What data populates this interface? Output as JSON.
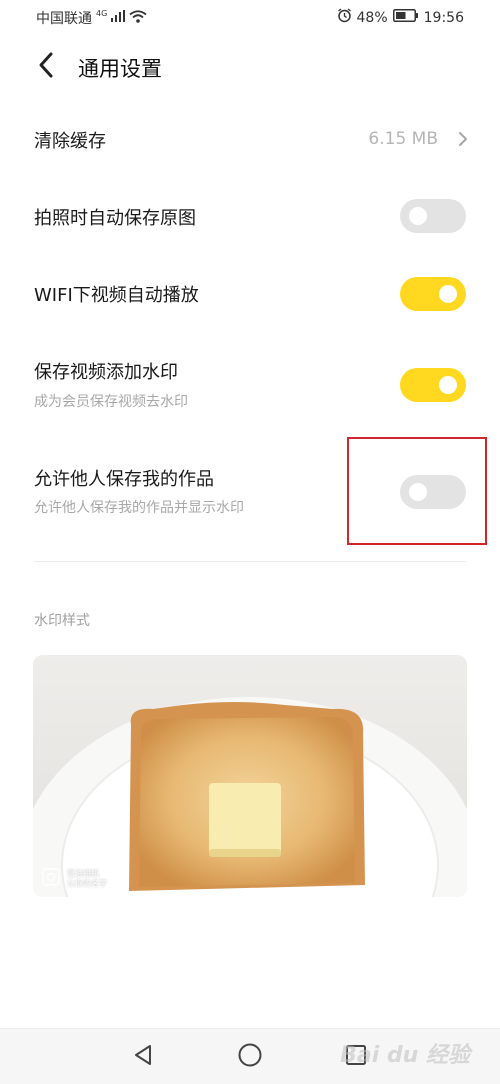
{
  "status_bar": {
    "carrier": "中国联通",
    "network": "4G",
    "battery": "48%",
    "time": "19:56"
  },
  "header": {
    "title": "通用设置"
  },
  "settings": {
    "clear_cache": {
      "label": "清除缓存",
      "value": "6.15 MB"
    },
    "auto_save_original": {
      "label": "拍照时自动保存原图",
      "enabled": false
    },
    "wifi_autoplay": {
      "label": "WIFI下视频自动播放",
      "enabled": true
    },
    "video_watermark": {
      "label": "保存视频添加水印",
      "subtitle": "成为会员保存视频去水印",
      "enabled": true
    },
    "allow_others_save": {
      "label": "允许他人保存我的作品",
      "subtitle": "允许他人保存我的作品并显示水印",
      "enabled": false
    }
  },
  "watermark_section": {
    "label": "水印样式",
    "stamp_line1": "富油相机",
    "stamp_line2": "认你的名字"
  },
  "nav_bar": {
    "watermark_text": "Bai du 经验"
  },
  "colors": {
    "toggle_on": "#ffd81f",
    "toggle_off": "#e3e3e3",
    "highlight": "#d1262c"
  }
}
